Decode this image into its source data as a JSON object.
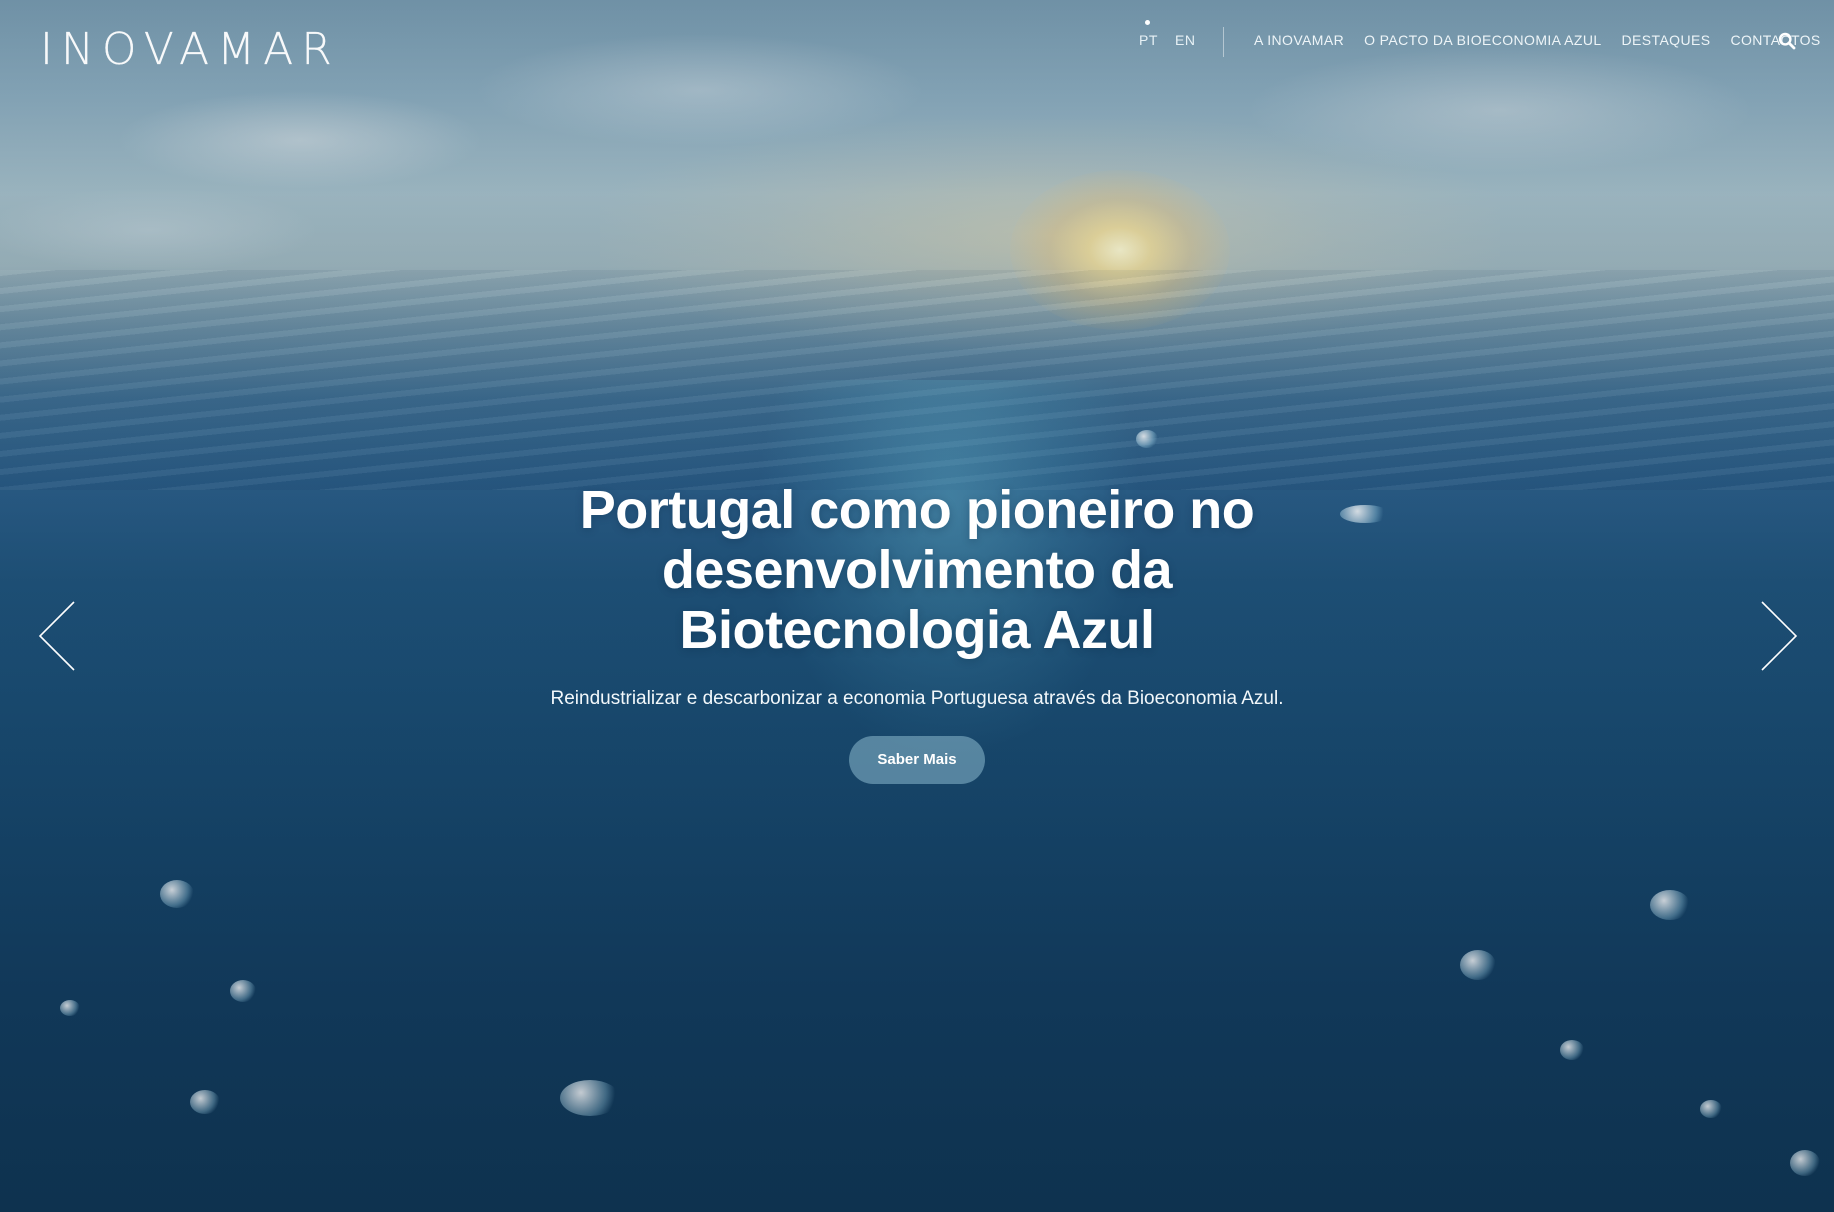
{
  "header": {
    "logo_text": "INOVAMAR",
    "languages": [
      {
        "label": "PT",
        "active": true
      },
      {
        "label": "EN",
        "active": false
      }
    ],
    "nav": [
      {
        "label": "A INOVAMAR"
      },
      {
        "label": "O PACTO DA BIOECONOMIA AZUL"
      },
      {
        "label": "DESTAQUES"
      },
      {
        "label": "CONTACTOS"
      }
    ],
    "search_icon": "search-icon"
  },
  "hero": {
    "title_lines": [
      "Portugal como pioneiro no",
      "desenvolvimento da",
      "Biotecnologia Azul"
    ],
    "subtitle": "Reindustrializar e descarbonizar a economia Portuguesa através da Bioeconomia Azul.",
    "cta_label": "Saber Mais",
    "prev_icon": "chevron-left-icon",
    "next_icon": "chevron-right-icon"
  },
  "colors": {
    "text": "#ffffff",
    "cta_background": "#8cb9cd",
    "ocean_dark": "#103654",
    "sky_light": "#a7c1cb"
  }
}
